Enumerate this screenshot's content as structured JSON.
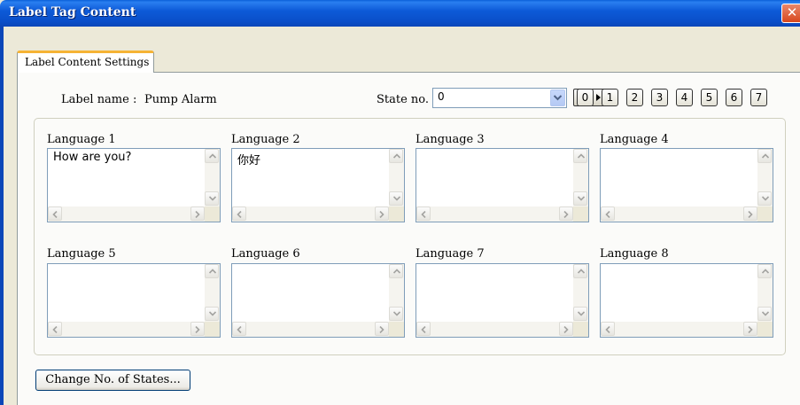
{
  "window": {
    "title": "Label Tag Content",
    "close_glyph": "✕",
    "accent_color": "#0a4fc9"
  },
  "tabs": [
    {
      "label": "Label Content Settings",
      "active": true
    }
  ],
  "label": {
    "name_caption": "Label name :",
    "name_value": "Pump Alarm"
  },
  "state": {
    "caption": "State no. :",
    "selected": "0",
    "prev_icon": "triangle-left-icon",
    "next_icon": "triangle-right-icon",
    "buttons": [
      "0",
      "1",
      "2",
      "3",
      "4",
      "5",
      "6",
      "7"
    ]
  },
  "languages": [
    {
      "label": "Language 1",
      "text": "How are you?"
    },
    {
      "label": "Language 2",
      "text": "你好"
    },
    {
      "label": "Language 3",
      "text": ""
    },
    {
      "label": "Language 4",
      "text": ""
    },
    {
      "label": "Language 5",
      "text": ""
    },
    {
      "label": "Language 6",
      "text": ""
    },
    {
      "label": "Language 7",
      "text": ""
    },
    {
      "label": "Language 8",
      "text": ""
    }
  ],
  "actions": {
    "change_states_label": "Change No. of States..."
  }
}
